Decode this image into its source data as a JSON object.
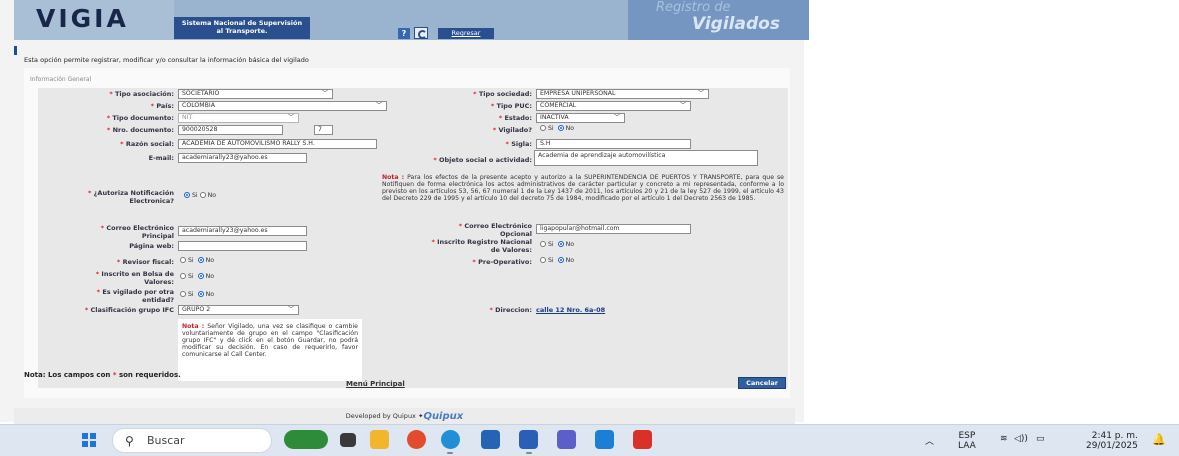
{
  "header": {
    "logo": "VIGIA",
    "subtitle_line1": "Sistema Nacional de Supervisión",
    "subtitle_line2": "al Transporte.",
    "help_label": "?",
    "back_button": "Regresar",
    "module_line1": "Registro de",
    "module_line2": "Vigilados"
  },
  "intro": "Esta opción permite registrar, modificar y/o consultar la información básica del vigilado",
  "section_title": "Información General",
  "fields": {
    "tipo_asociacion": {
      "label": "Tipo asociación:",
      "value": "SOCIETARIO"
    },
    "tipo_sociedad": {
      "label": "Tipo sociedad:",
      "value": "EMPRESA UNIPERSONAL"
    },
    "pais": {
      "label": "País:",
      "value": "COLOMBIA"
    },
    "tipo_puc": {
      "label": "Tipo PUC:",
      "value": "COMERCIAL"
    },
    "tipo_documento": {
      "label": "Tipo documento:",
      "value": "NIT"
    },
    "estado": {
      "label": "Estado:",
      "value": "INACTIVA"
    },
    "nro_documento": {
      "label": "Nro. documento:",
      "value": "900020528",
      "dv": "7"
    },
    "vigilado": {
      "label": "Vigilado?",
      "selected": "No"
    },
    "razon_social": {
      "label": "Razón social:",
      "value": "ACADEMIA DE AUTOMOVILISMO RALLY S.H."
    },
    "sigla": {
      "label": "Sigla:",
      "value": "S.H"
    },
    "email": {
      "label": "E-mail:",
      "value": "academiarally23@yahoo.es"
    },
    "objeto_social": {
      "label": "Objeto social o actividad:",
      "value": "Academia de aprendizaje automovilística"
    },
    "autoriza": {
      "label_line1": "¿Autoriza Notificación",
      "label_line2": "Electronica?",
      "selected": "Si"
    },
    "correo_principal": {
      "label_line1": "Correo Electrónico",
      "label_line2": "Principal",
      "value": "academiarally23@yahoo.es"
    },
    "correo_opcional": {
      "label_line1": "Correo Electrónico",
      "label_line2": "Opcional",
      "value": "ligapopular@hotmail.com"
    },
    "pagina_web": {
      "label": "Página web:",
      "value": ""
    },
    "registro_nacional": {
      "label_line1": "Inscrito Registro Nacional",
      "label_line2": "de Valores:",
      "selected": "No"
    },
    "revisor_fiscal": {
      "label": "Revisor fiscal:",
      "selected": "No"
    },
    "pre_operativo": {
      "label": "Pre-Operativo:",
      "selected": "No"
    },
    "bolsa_valores": {
      "label_line1": "Inscrito en Bolsa de",
      "label_line2": "Valores:",
      "selected": "No"
    },
    "vigilado_otra": {
      "label_line1": "Es vigilado por otra",
      "label_line2": "entidad?",
      "selected": "No"
    },
    "clasificacion_ifc": {
      "label": "Clasificación grupo IFC",
      "value": "GRUPO 2"
    },
    "direccion": {
      "label": "Direccion:",
      "value": "calle 12 Nro. 6a-08"
    }
  },
  "radio_labels": {
    "si": "Si",
    "no": "No"
  },
  "note_autoriza": {
    "prefix": "Nota :",
    "text": "Para los efectos de la presente acepto y autorizo a la SUPERINTENDENCIA DE PUERTOS Y TRANSPORTE, para que se Notifiquen de forma electrónica los actos administrativos de carácter particular y concreto a mi representada, conforme a lo previsto en los artículos 53, 56, 67 numeral 1 de la Ley 1437 de 2011, los artículos 20 y 21 de la ley 527 de 1999, el artículo 43 del Decreto 229 de 1995 y el artículo 10 del decreto 75 de 1984, modificado por el artículo 1 del Decreto 2563 de 1985."
  },
  "note_ifc": {
    "prefix": "Nota :",
    "text": "Señor Vigilado, una vez se clasifique o cambie voluntariamente de grupo en el campo \"Clasificación grupo IFC\" y dé click en el botón Guardar, no podrá modificar su decisión. En caso de requerirlo, favor comunicarse al Call Center."
  },
  "required_note": {
    "prefix": "Nota: Los campos con",
    "star": "*",
    "suffix": "son requeridos."
  },
  "menu_link": "Menú Principal",
  "cancel_button": "Cancelar",
  "footer": {
    "text": "Developed by Quipux",
    "brand": "Quipux"
  },
  "taskbar": {
    "search_placeholder": "Buscar",
    "language_line1": "ESP",
    "language_line2": "LAA",
    "time": "2:41 p. m.",
    "date": "29/01/2025"
  }
}
